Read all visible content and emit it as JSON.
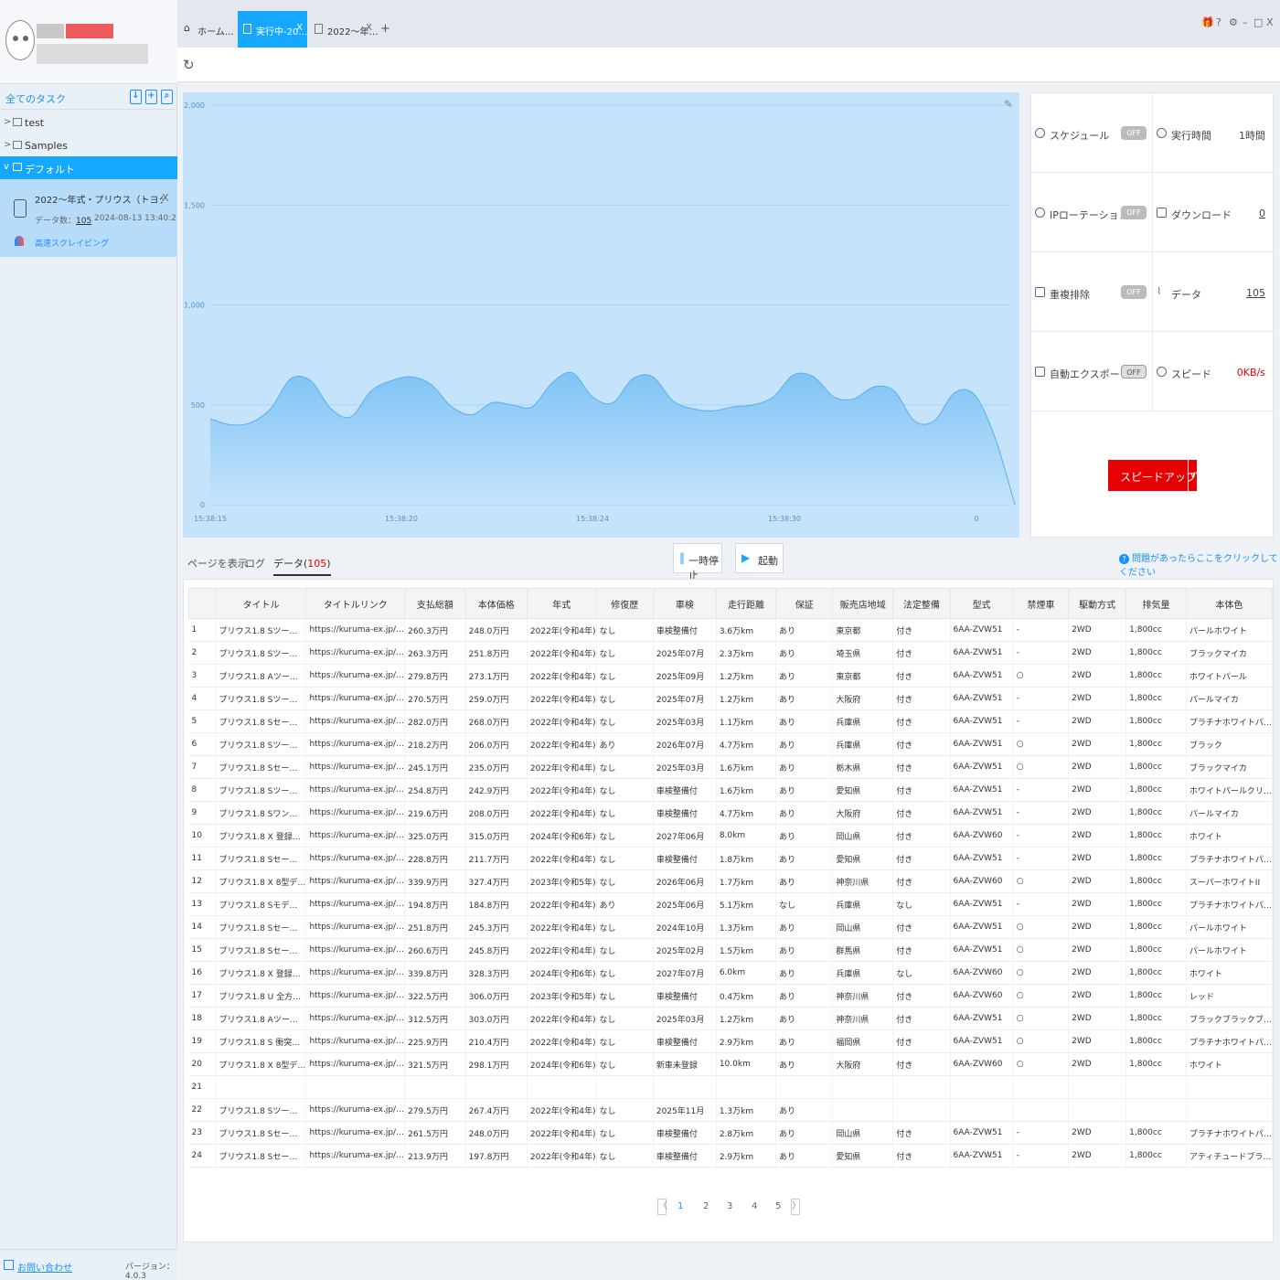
{
  "sidebar": {
    "header_title": "全てのタスク",
    "tree": [
      {
        "label": "test"
      },
      {
        "label": "Samples"
      },
      {
        "label": "デフォルト"
      }
    ],
    "task": {
      "title": "2022〜年式・プリウス（トヨタ）の中古車…",
      "data_count_label": "データ数：",
      "data_count": "105",
      "datetime": "2024-08-13 13:40:2",
      "mode": "高速スクレイピング",
      "close": "X"
    },
    "footer": {
      "contact": "お問い合わせ",
      "version": "バージョン：4.0.3"
    }
  },
  "tabs": [
    {
      "label": "ホーム…"
    },
    {
      "label": "実行中-20…",
      "close": "X"
    },
    {
      "label": "2022〜年…",
      "close": "X"
    }
  ],
  "tab_add": "+",
  "window_buttons": [
    "🎁",
    "?",
    "⚙",
    "–",
    "□",
    "X"
  ],
  "chart_data": {
    "type": "area",
    "x_ticks": [
      "15:38:15",
      "15:38:20",
      "15:38:24",
      "15:38:30",
      "0"
    ],
    "y_ticks": [
      "2,000",
      "1,500",
      "1,000",
      "500",
      "0"
    ],
    "ylim": [
      0,
      2000
    ],
    "values": [
      430,
      400,
      410,
      480,
      630,
      620,
      480,
      440,
      570,
      620,
      640,
      600,
      490,
      450,
      510,
      500,
      490,
      610,
      660,
      540,
      510,
      630,
      640,
      520,
      480,
      470,
      490,
      500,
      540,
      650,
      640,
      540,
      530,
      590,
      570,
      420,
      420,
      560,
      550,
      340,
      0
    ]
  },
  "stats": {
    "schedule": {
      "label": "スケジュール",
      "toggle": "OFF"
    },
    "exec_time": {
      "label": "実行時間",
      "value": "1時間"
    },
    "ip_rotation": {
      "label": "IPローテーション",
      "toggle": "OFF"
    },
    "download": {
      "label": "ダウンロード",
      "value": "0"
    },
    "dedupe": {
      "label": "重複排除",
      "toggle": "OFF"
    },
    "data": {
      "label": "データ",
      "value": "105"
    },
    "auto_export": {
      "label": "自動エクスポート",
      "toggle": "OFF"
    },
    "speed": {
      "label": "スピード",
      "value": "0KB/s"
    },
    "speedup_button": "スピードアップ",
    "speedup_dropdown": "∨"
  },
  "views": {
    "page": "ページを表示",
    "log": "ログ",
    "data": "データ(",
    "data_count": "105",
    "data_close": ")"
  },
  "controls": {
    "pause": "一時停止",
    "start": "起動"
  },
  "help": "問題があったらここをクリックしてください",
  "table": {
    "headers": [
      "",
      "タイトル",
      "タイトルリンク",
      "支払総額",
      "本体価格",
      "年式",
      "修復歴",
      "車検",
      "走行距離",
      "保証",
      "販売店地域",
      "法定整備",
      "型式",
      "禁煙車",
      "駆動方式",
      "排気量",
      "本体色"
    ],
    "rows": [
      [
        "1",
        "プリウス1.8 Sツー…",
        "https://kuruma-ex.jp/…",
        "260.3万円",
        "248.0万円",
        "2022年(令和4年)",
        "なし",
        "車検整備付",
        "3.6万km",
        "あり",
        "東京都",
        "付き",
        "6AA-ZVW51",
        "-",
        "2WD",
        "1,800cc",
        "パールホワイト"
      ],
      [
        "2",
        "プリウス1.8 Sツー…",
        "https://kuruma-ex.jp/…",
        "263.3万円",
        "251.8万円",
        "2022年(令和4年)",
        "なし",
        "2025年07月",
        "2.3万km",
        "あり",
        "埼玉県",
        "付き",
        "6AA-ZVW51",
        "-",
        "2WD",
        "1,800cc",
        "ブラックマイカ"
      ],
      [
        "3",
        "プリウス1.8 Aツー…",
        "https://kuruma-ex.jp/…",
        "279.8万円",
        "273.1万円",
        "2022年(令和4年)",
        "なし",
        "2025年09月",
        "1.2万km",
        "あり",
        "東京都",
        "付き",
        "6AA-ZVW51",
        "○",
        "2WD",
        "1,800cc",
        "ホワイトパール"
      ],
      [
        "4",
        "プリウス1.8 Sツー…",
        "https://kuruma-ex.jp/…",
        "270.5万円",
        "259.0万円",
        "2022年(令和4年)",
        "なし",
        "2025年07月",
        "1.2万km",
        "あり",
        "大阪府",
        "付き",
        "6AA-ZVW51",
        "-",
        "2WD",
        "1,800cc",
        "パールマイカ"
      ],
      [
        "5",
        "プリウス1.8 Sセー…",
        "https://kuruma-ex.jp/…",
        "282.0万円",
        "268.0万円",
        "2022年(令和4年)",
        "なし",
        "2025年03月",
        "1.1万km",
        "あり",
        "兵庫県",
        "付き",
        "6AA-ZVW51",
        "-",
        "2WD",
        "1,800cc",
        "プラチナホワイトパ…"
      ],
      [
        "6",
        "プリウス1.8 Sツー…",
        "https://kuruma-ex.jp/…",
        "218.2万円",
        "206.0万円",
        "2022年(令和4年)",
        "あり",
        "2026年07月",
        "4.7万km",
        "あり",
        "兵庫県",
        "付き",
        "6AA-ZVW51",
        "○",
        "2WD",
        "1,800cc",
        "ブラック"
      ],
      [
        "7",
        "プリウス1.8 Sセー…",
        "https://kuruma-ex.jp/…",
        "245.1万円",
        "235.0万円",
        "2022年(令和4年)",
        "なし",
        "2025年03月",
        "1.6万km",
        "あり",
        "栃木県",
        "付き",
        "6AA-ZVW51",
        "○",
        "2WD",
        "1,800cc",
        "ブラックマイカ"
      ],
      [
        "8",
        "プリウス1.8 Sツー…",
        "https://kuruma-ex.jp/…",
        "254.8万円",
        "242.9万円",
        "2022年(令和4年)",
        "なし",
        "車検整備付",
        "1.6万km",
        "あり",
        "愛知県",
        "付き",
        "6AA-ZVW51",
        "-",
        "2WD",
        "1,800cc",
        "ホワイトパールクリ…"
      ],
      [
        "9",
        "プリウス1.8 Sワン…",
        "https://kuruma-ex.jp/…",
        "219.6万円",
        "208.0万円",
        "2022年(令和4年)",
        "なし",
        "車検整備付",
        "4.7万km",
        "あり",
        "大阪府",
        "付き",
        "6AA-ZVW51",
        "-",
        "2WD",
        "1,800cc",
        "パールマイカ"
      ],
      [
        "10",
        "プリウス1.8 X 登録…",
        "https://kuruma-ex.jp/…",
        "325.0万円",
        "315.0万円",
        "2024年(令和6年)",
        "なし",
        "2027年06月",
        "8.0km",
        "あり",
        "岡山県",
        "付き",
        "6AA-ZVW60",
        "-",
        "2WD",
        "1,800cc",
        "ホワイト"
      ],
      [
        "11",
        "プリウス1.8 Sセー…",
        "https://kuruma-ex.jp/…",
        "228.8万円",
        "211.7万円",
        "2022年(令和4年)",
        "なし",
        "車検整備付",
        "1.8万km",
        "あり",
        "愛知県",
        "付き",
        "6AA-ZVW51",
        "-",
        "2WD",
        "1,800cc",
        "プラチナホワイトパ…"
      ],
      [
        "12",
        "プリウス1.8 X 8型デ…",
        "https://kuruma-ex.jp/…",
        "339.9万円",
        "327.4万円",
        "2023年(令和5年)",
        "なし",
        "2026年06月",
        "1.7万km",
        "あり",
        "神奈川県",
        "付き",
        "6AA-ZVW60",
        "○",
        "2WD",
        "1,800cc",
        "スーパーホワイトII"
      ],
      [
        "13",
        "プリウス1.8 Sモデ…",
        "https://kuruma-ex.jp/…",
        "194.8万円",
        "184.8万円",
        "2022年(令和4年)",
        "あり",
        "2025年06月",
        "5.1万km",
        "なし",
        "兵庫県",
        "なし",
        "6AA-ZVW51",
        "-",
        "2WD",
        "1,800cc",
        "プラチナホワイトパ…"
      ],
      [
        "14",
        "プリウス1.8 Sセー…",
        "https://kuruma-ex.jp/…",
        "251.8万円",
        "245.3万円",
        "2022年(令和4年)",
        "なし",
        "2024年10月",
        "1.3万km",
        "あり",
        "岡山県",
        "付き",
        "6AA-ZVW51",
        "○",
        "2WD",
        "1,800cc",
        "パールホワイト"
      ],
      [
        "15",
        "プリウス1.8 Sセー…",
        "https://kuruma-ex.jp/…",
        "260.6万円",
        "245.8万円",
        "2022年(令和4年)",
        "なし",
        "2025年02月",
        "1.5万km",
        "あり",
        "群馬県",
        "付き",
        "6AA-ZVW51",
        "○",
        "2WD",
        "1,800cc",
        "パールホワイト"
      ],
      [
        "16",
        "プリウス1.8 X 登録…",
        "https://kuruma-ex.jp/…",
        "339.8万円",
        "328.3万円",
        "2024年(令和6年)",
        "なし",
        "2027年07月",
        "6.0km",
        "あり",
        "兵庫県",
        "なし",
        "6AA-ZVW60",
        "○",
        "2WD",
        "1,800cc",
        "ホワイト"
      ],
      [
        "17",
        "プリウス1.8 U 全方…",
        "https://kuruma-ex.jp/…",
        "322.5万円",
        "306.0万円",
        "2023年(令和5年)",
        "なし",
        "車検整備付",
        "0.4万km",
        "あり",
        "神奈川県",
        "付き",
        "6AA-ZVW60",
        "○",
        "2WD",
        "1,800cc",
        "レッド"
      ],
      [
        "18",
        "プリウス1.8 Aツー…",
        "https://kuruma-ex.jp/…",
        "312.5万円",
        "303.0万円",
        "2022年(令和4年)",
        "なし",
        "2025年03月",
        "1.2万km",
        "あり",
        "神奈川県",
        "付き",
        "6AA-ZVW51",
        "○",
        "2WD",
        "1,800cc",
        "ブラックブラックブ…"
      ],
      [
        "19",
        "プリウス1.8 S 衝突…",
        "https://kuruma-ex.jp/…",
        "225.9万円",
        "210.4万円",
        "2022年(令和4年)",
        "なし",
        "車検整備付",
        "2.9万km",
        "あり",
        "福岡県",
        "付き",
        "6AA-ZVW51",
        "○",
        "2WD",
        "1,800cc",
        "プラチナホワイトパ…"
      ],
      [
        "20",
        "プリウス1.8 X 8型デ…",
        "https://kuruma-ex.jp/…",
        "321.5万円",
        "298.1万円",
        "2024年(令和6年)",
        "なし",
        "新車未登録",
        "10.0km",
        "あり",
        "大阪府",
        "付き",
        "6AA-ZVW60",
        "○",
        "2WD",
        "1,800cc",
        "ホワイト"
      ],
      [
        "21",
        "",
        "",
        "",
        "",
        "",
        "",
        "",
        "",
        "",
        "",
        "",
        "",
        "",
        "",
        "",
        ""
      ],
      [
        "22",
        "プリウス1.8 Sツー…",
        "https://kuruma-ex.jp/…",
        "279.5万円",
        "267.4万円",
        "2022年(令和4年)",
        "なし",
        "2025年11月",
        "1.3万km",
        "あり",
        "",
        "",
        "",
        "",
        "",
        "",
        ""
      ],
      [
        "23",
        "プリウス1.8 Sセー…",
        "https://kuruma-ex.jp/…",
        "261.5万円",
        "248.0万円",
        "2022年(令和4年)",
        "なし",
        "車検整備付",
        "2.8万km",
        "あり",
        "岡山県",
        "付き",
        "6AA-ZVW51",
        "-",
        "2WD",
        "1,800cc",
        "プラチナホワイトパ…"
      ],
      [
        "24",
        "プリウス1.8 Sセー…",
        "https://kuruma-ex.jp/…",
        "213.9万円",
        "197.8万円",
        "2022年(令和4年)",
        "なし",
        "車検整備付",
        "2.9万km",
        "あり",
        "愛知県",
        "付き",
        "6AA-ZVW51",
        "-",
        "2WD",
        "1,800cc",
        "アティチュードブラ…"
      ]
    ]
  },
  "pager": {
    "prev": "〈",
    "pages": [
      "1",
      "2",
      "3",
      "4",
      "5"
    ],
    "next": "〉",
    "current": "1"
  }
}
